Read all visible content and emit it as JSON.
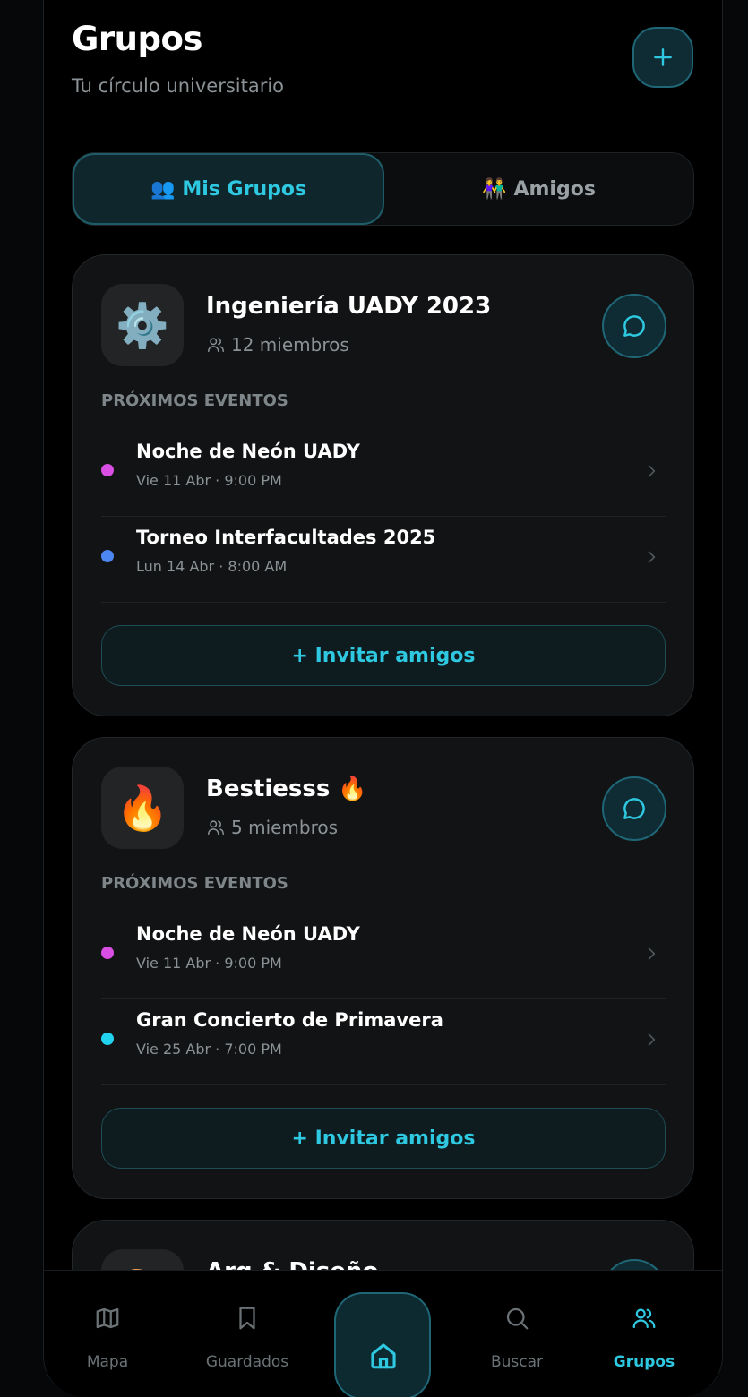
{
  "header": {
    "title": "Grupos",
    "subtitle": "Tu círculo universitario",
    "add_icon": "plus-icon"
  },
  "tabs": [
    {
      "emoji": "👥",
      "label": "Mis Grupos",
      "active": true
    },
    {
      "emoji": "👫",
      "label": "Amigos",
      "active": false
    }
  ],
  "groups": [
    {
      "emoji": "⚙️",
      "name": "Ingeniería UADY 2023",
      "members": "12 miembros",
      "section_label": "PRÓXIMOS EVENTOS",
      "events": [
        {
          "name": "Noche de Neón UADY",
          "date": "Vie 11 Abr · 9:00 PM",
          "color": "#d94fe3"
        },
        {
          "name": "Torneo Interfacultades 2025",
          "date": "Lun 14 Abr · 8:00 AM",
          "color": "#4c86f0"
        }
      ],
      "invite_label": "+ Invitar amigos"
    },
    {
      "emoji": "🔥",
      "name": "Bestiesss 🔥",
      "members": "5 miembros",
      "section_label": "PRÓXIMOS EVENTOS",
      "events": [
        {
          "name": "Noche de Neón UADY",
          "date": "Vie 11 Abr · 9:00 PM",
          "color": "#d94fe3"
        },
        {
          "name": "Gran Concierto de Primavera",
          "date": "Vie 25 Abr · 7:00 PM",
          "color": "#22d3ee"
        }
      ],
      "invite_label": "+ Invitar amigos"
    },
    {
      "emoji": "🎨",
      "name": "Arq & Diseño"
    }
  ],
  "nav": [
    {
      "label": "Mapa",
      "icon": "map-icon",
      "active": false
    },
    {
      "label": "Guardados",
      "icon": "bookmark-icon",
      "active": false
    },
    {
      "label": "",
      "icon": "home-icon",
      "active": false
    },
    {
      "label": "Buscar",
      "icon": "search-icon",
      "active": false
    },
    {
      "label": "Grupos",
      "icon": "users-icon",
      "active": true
    }
  ],
  "colors": {
    "accent": "#2ec8e0",
    "background": "#000000",
    "card": "#121314"
  }
}
